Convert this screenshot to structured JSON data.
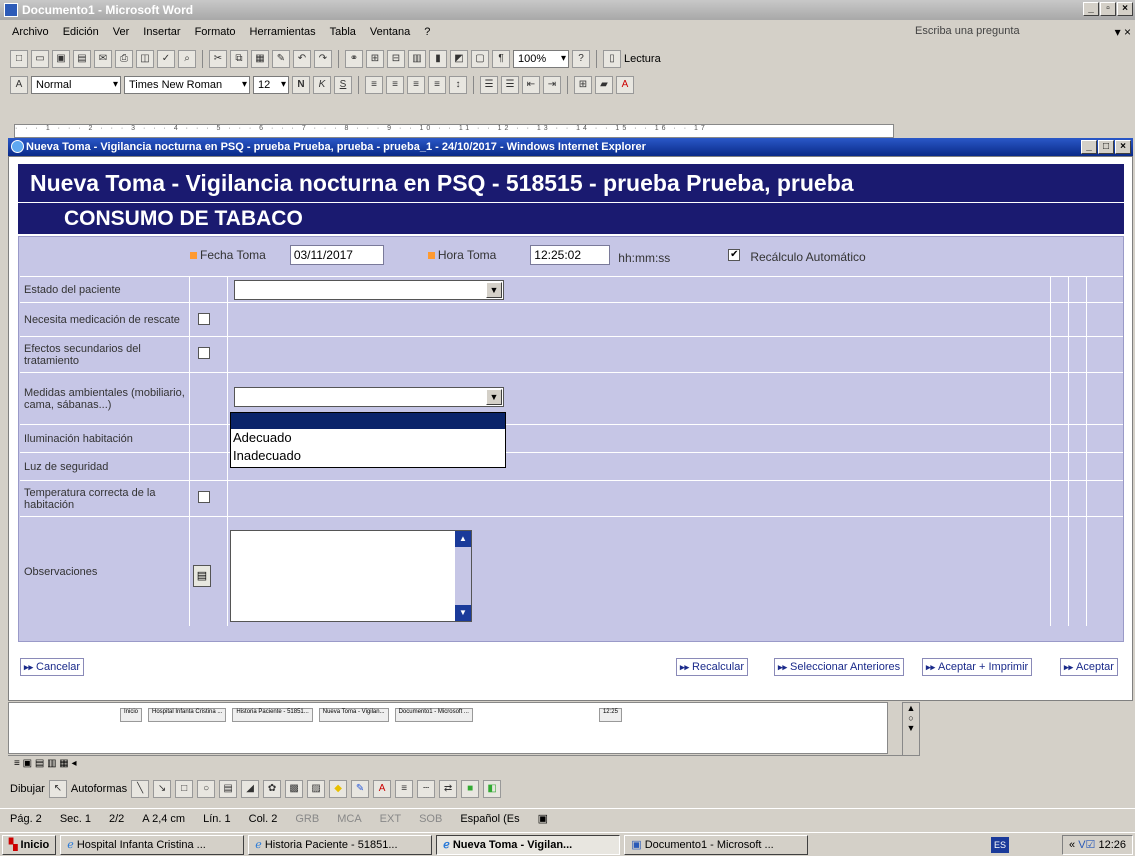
{
  "word": {
    "title": "Documento1 - Microsoft Word",
    "menu": [
      "Archivo",
      "Edición",
      "Ver",
      "Insertar",
      "Formato",
      "Herramientas",
      "Tabla",
      "Ventana",
      "?"
    ],
    "ask_placeholder": "Escriba una pregunta",
    "zoom": "100%",
    "reading": "Lectura",
    "style": "Normal",
    "font": "Times New Roman",
    "size": "12",
    "draw_label": "Dibujar",
    "autoshapes": "Autoformas",
    "status": {
      "page": "Pág. 2",
      "section": "Sec. 1",
      "pages": "2/2",
      "at": "A 2,4 cm",
      "line": "Lín. 1",
      "col": "Col. 2",
      "grb": "GRB",
      "mca": "MCA",
      "ext": "EXT",
      "sob": "SOB",
      "lang": "Español (Es"
    }
  },
  "ie": {
    "title": "Nueva Toma - Vigilancia nocturna en PSQ - prueba Prueba, prueba - prueba_1 - 24/10/2017 - Windows Internet Explorer"
  },
  "form": {
    "header": "Nueva Toma - Vigilancia nocturna en PSQ - 518515 - prueba Prueba, prueba",
    "subheader": "CONSUMO DE TABACO",
    "fecha_label": "Fecha Toma",
    "fecha_value": "03/11/2017",
    "hora_label": "Hora Toma",
    "hora_value": "12:25:02",
    "hora_format": "hh:mm:ss",
    "recalc_label": "Recálculo Automático",
    "rows": [
      {
        "label": "Estado del paciente"
      },
      {
        "label": "Necesita medicación de rescate"
      },
      {
        "label": "Efectos secundarios del tratamiento"
      },
      {
        "label": "Medidas ambientales (mobiliario, cama, sábanas...)"
      },
      {
        "label": "Iluminación habitación"
      },
      {
        "label": "Luz de seguridad"
      },
      {
        "label": "Temperatura correcta de la habitación"
      },
      {
        "label": "Observaciones"
      }
    ],
    "dropdown_options": [
      "Adecuado",
      "Inadecuado"
    ],
    "buttons": {
      "cancel": "Cancelar",
      "recalc": "Recalcular",
      "select_prev": "Seleccionar Anteriores",
      "accept_print": "Aceptar + Imprimir",
      "accept": "Aceptar"
    }
  },
  "taskbar": {
    "start": "Inicio",
    "tasks": [
      "Hospital Infanta Cristina ...",
      "Historia Paciente - 51851...",
      "Nueva Toma - Vigilan...",
      "Documento1 - Microsoft ..."
    ],
    "lang": "ES",
    "time": "12:26"
  },
  "mini_taskbar": {
    "start": "Inicio",
    "tasks": [
      "Hospital Infanta Cristina ...",
      "Historia Paciente - 51851...",
      "Nueva Toma - Vigilan...",
      "Documento1 - Microsoft ..."
    ],
    "time": "12:25"
  }
}
